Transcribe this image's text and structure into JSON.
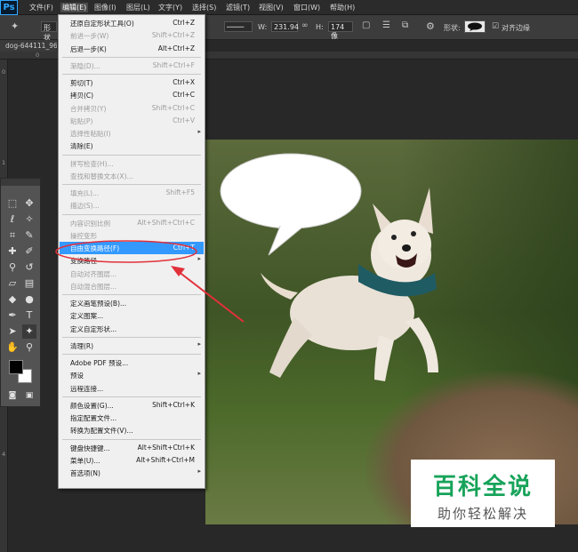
{
  "app": {
    "logo": "Ps"
  },
  "menubar": {
    "items": [
      "文件(F)",
      "编辑(E)",
      "图像(I)",
      "图层(L)",
      "文字(Y)",
      "选择(S)",
      "滤镜(T)",
      "视图(V)",
      "窗口(W)",
      "帮助(H)"
    ],
    "active_index": 1
  },
  "options_bar": {
    "shape_mode": "形状",
    "w_label": "W:",
    "w_value": "231.94",
    "h_label": "H:",
    "h_value": "174 像",
    "shape_label": "形状:",
    "align_edges_label": "对齐边缘",
    "align_edges_checked": true
  },
  "document": {
    "tab_title": "dog-644111_96",
    "ruler_top": [
      "0",
      "5"
    ],
    "ruler_left": [
      "0",
      "1",
      "2",
      "3",
      "4"
    ]
  },
  "watermark": {
    "title": "百科全说",
    "subtitle": "助你轻松解决"
  },
  "edit_menu": {
    "items": [
      {
        "label": "还原自定形状工具(O)",
        "shortcut": "Ctrl+Z",
        "enabled": true
      },
      {
        "label": "前进一步(W)",
        "shortcut": "Shift+Ctrl+Z",
        "enabled": false
      },
      {
        "label": "后退一步(K)",
        "shortcut": "Alt+Ctrl+Z",
        "enabled": true
      },
      {
        "sep": true
      },
      {
        "label": "渐隐(D)...",
        "shortcut": "Shift+Ctrl+F",
        "enabled": false
      },
      {
        "sep": true
      },
      {
        "label": "剪切(T)",
        "shortcut": "Ctrl+X",
        "enabled": true
      },
      {
        "label": "拷贝(C)",
        "shortcut": "Ctrl+C",
        "enabled": true
      },
      {
        "label": "合并拷贝(Y)",
        "shortcut": "Shift+Ctrl+C",
        "enabled": false
      },
      {
        "label": "粘贴(P)",
        "shortcut": "Ctrl+V",
        "enabled": false
      },
      {
        "label": "选择性粘贴(I)",
        "shortcut": "",
        "enabled": false,
        "submenu": true
      },
      {
        "label": "清除(E)",
        "shortcut": "",
        "enabled": true
      },
      {
        "sep": true
      },
      {
        "label": "拼写检查(H)...",
        "shortcut": "",
        "enabled": false
      },
      {
        "label": "查找和替换文本(X)...",
        "shortcut": "",
        "enabled": false
      },
      {
        "sep": true
      },
      {
        "label": "填充(L)...",
        "shortcut": "Shift+F5",
        "enabled": false
      },
      {
        "label": "描边(S)...",
        "shortcut": "",
        "enabled": false
      },
      {
        "sep": true
      },
      {
        "label": "内容识别比例",
        "shortcut": "Alt+Shift+Ctrl+C",
        "enabled": false
      },
      {
        "label": "操控变形",
        "shortcut": "",
        "enabled": false
      },
      {
        "label": "自由变换路径(F)",
        "shortcut": "Ctrl+T",
        "enabled": true,
        "highlighted": true
      },
      {
        "label": "变换路径",
        "shortcut": "",
        "enabled": true,
        "submenu": true
      },
      {
        "label": "自动对齐图层...",
        "shortcut": "",
        "enabled": false
      },
      {
        "label": "自动混合图层...",
        "shortcut": "",
        "enabled": false
      },
      {
        "sep": true
      },
      {
        "label": "定义画笔预设(B)...",
        "shortcut": "",
        "enabled": true
      },
      {
        "label": "定义图案...",
        "shortcut": "",
        "enabled": true
      },
      {
        "label": "定义自定形状...",
        "shortcut": "",
        "enabled": true
      },
      {
        "sep": true
      },
      {
        "label": "清理(R)",
        "shortcut": "",
        "enabled": true,
        "submenu": true
      },
      {
        "sep": true
      },
      {
        "label": "Adobe PDF 预设...",
        "shortcut": "",
        "enabled": true
      },
      {
        "label": "预设",
        "shortcut": "",
        "enabled": true,
        "submenu": true
      },
      {
        "label": "远程连接...",
        "shortcut": "",
        "enabled": true
      },
      {
        "sep": true
      },
      {
        "label": "颜色设置(G)...",
        "shortcut": "Shift+Ctrl+K",
        "enabled": true
      },
      {
        "label": "指定配置文件...",
        "shortcut": "",
        "enabled": true
      },
      {
        "label": "转换为配置文件(V)...",
        "shortcut": "",
        "enabled": true
      },
      {
        "sep": true
      },
      {
        "label": "键盘快捷键...",
        "shortcut": "Alt+Shift+Ctrl+K",
        "enabled": true
      },
      {
        "label": "菜单(U)...",
        "shortcut": "Alt+Shift+Ctrl+M",
        "enabled": true
      },
      {
        "label": "首选项(N)",
        "shortcut": "",
        "enabled": true,
        "submenu": true
      }
    ]
  },
  "colors": {
    "highlight": "#3399ff",
    "annotation": "#e2303a",
    "watermark_green": "#17a35a"
  }
}
